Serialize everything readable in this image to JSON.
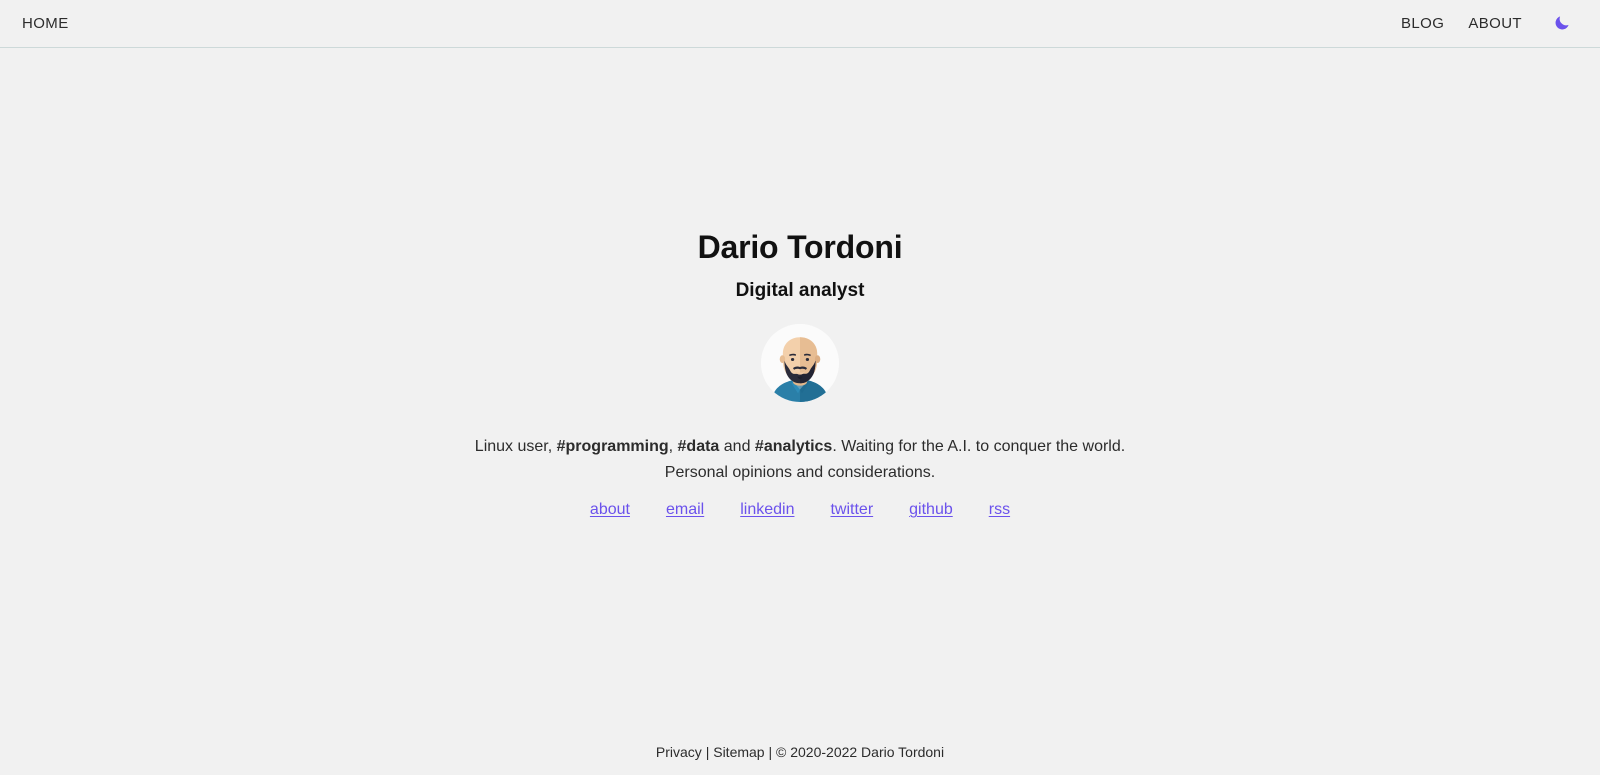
{
  "theme": {
    "background": "#f1f1f1",
    "text": "#2c2c2c",
    "heading": "#111111",
    "accent": "#6b52ec",
    "header_border": "#cdd9d9"
  },
  "header": {
    "left_nav": [
      {
        "label": "HOME",
        "name": "nav-link-home"
      }
    ],
    "right_nav": [
      {
        "label": "BLOG",
        "name": "nav-link-blog"
      },
      {
        "label": "ABOUT",
        "name": "nav-link-about"
      }
    ],
    "theme_toggle": {
      "icon": "moon-icon",
      "color": "#6b52ec"
    }
  },
  "main": {
    "title": "Dario Tordoni",
    "subtitle": "Digital analyst",
    "avatar": {
      "name": "avatar-illustration",
      "alt": "Illustrated portrait of a bald bearded man in a teal shirt",
      "circle_background": "#fbfbfb",
      "skin": "#f3d0ab",
      "skin_shadow": "#e7bd93",
      "beard": "#2b2c3a",
      "shirt": "#2a7fa8",
      "shirt_shadow": "#1f6b91",
      "collar": "#2f87b1"
    },
    "bio": {
      "line1_part1": "Linux user, ",
      "tag1": "#programming",
      "line1_part2": ", ",
      "tag2": "#data",
      "line1_part3": " and ",
      "tag3": "#analytics",
      "line1_part4": ". Waiting for the A.I. to conquer the world.",
      "line2": "Personal opinions and considerations."
    },
    "social_links": [
      {
        "label": "about",
        "name": "social-link-about"
      },
      {
        "label": "email",
        "name": "social-link-email"
      },
      {
        "label": "linkedin",
        "name": "social-link-linkedin"
      },
      {
        "label": "twitter",
        "name": "social-link-twitter"
      },
      {
        "label": "github",
        "name": "social-link-github"
      },
      {
        "label": "rss",
        "name": "social-link-rss"
      }
    ]
  },
  "footer": {
    "privacy": "Privacy",
    "sep1": " | ",
    "sitemap": "Sitemap",
    "sep2": " | ",
    "copyright": "© 2020-2022 Dario Tordoni"
  }
}
